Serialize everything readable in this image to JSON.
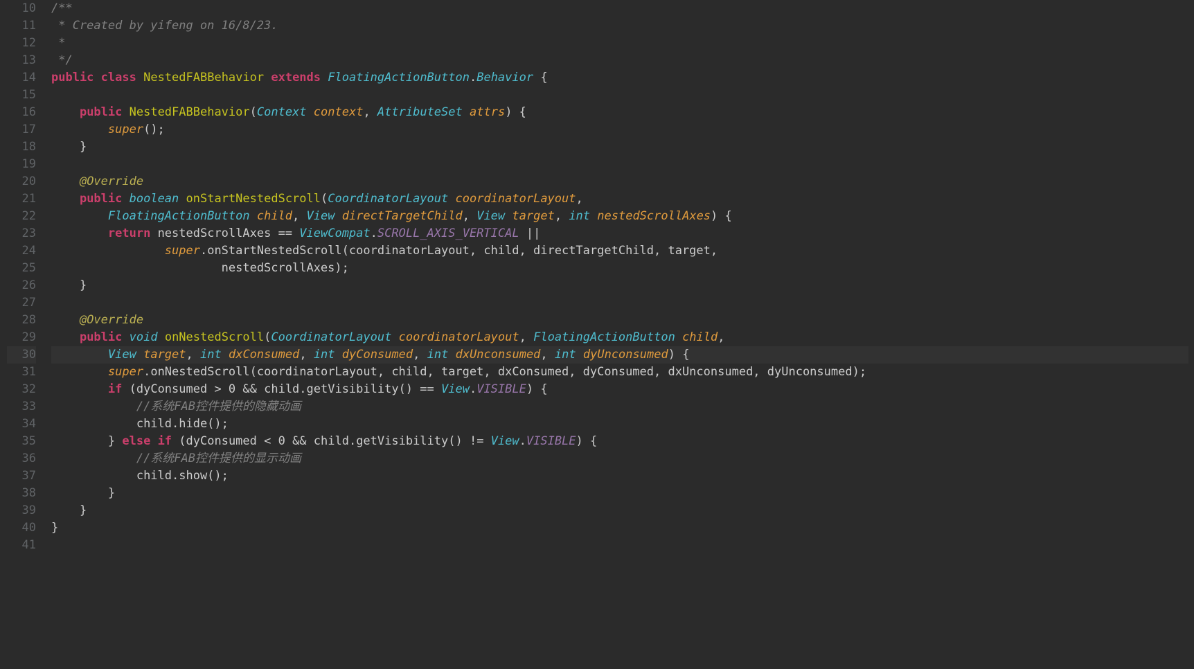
{
  "first_line_no": 10,
  "highlight_line": 30,
  "tokens": {
    "l10": {
      "comment": "/**"
    },
    "l11": {
      "comment": " * Created by yifeng on 16/8/23."
    },
    "l12": {
      "comment": " *"
    },
    "l13": {
      "comment": " */"
    },
    "l14": {
      "kw_public": "public",
      "kw_class": "class",
      "cls": "NestedFABBehavior",
      "kw_extends": "extends",
      "type": "FloatingActionButton",
      "dot": ".",
      "beh": "Behavior",
      "brace": " {"
    },
    "l16": {
      "kw_public": "public",
      "ctor": "NestedFABBehavior",
      "paren_o": "(",
      "t1": "Context",
      "p1": "context",
      "comma": ", ",
      "t2": "AttributeSet",
      "p2": "attrs",
      "paren_c": ")",
      "brace": " {"
    },
    "l17": {
      "super": "super",
      "rest": "();"
    },
    "l18": {
      "brace": "}"
    },
    "l20": {
      "annot": "@Override"
    },
    "l21": {
      "kw_public": "public",
      "t_ret": "boolean",
      "m": "onStartNestedScroll",
      "paren_o": "(",
      "t1": "CoordinatorLayout",
      "p1": "coordinatorLayout",
      "comma": ","
    },
    "l22": {
      "t1": "FloatingActionButton",
      "p1": "child",
      "c1": ", ",
      "t2": "View",
      "p2": "directTargetChild",
      "c2": ", ",
      "t3": "View",
      "p3": "target",
      "c3": ", ",
      "t4": "int",
      "p4": "nestedScrollAxes",
      "paren_c": ")",
      "brace": " {"
    },
    "l23": {
      "kw_return": "return",
      "p1": "nestedScrollAxes",
      "eq": " == ",
      "t": "ViewCompat",
      "dot": ".",
      "c": "SCROLL_AXIS_VERTICAL",
      "or": " ||"
    },
    "l24": {
      "super": "super",
      "dot": ".",
      "m": "onStartNestedScroll",
      "rest": "(coordinatorLayout, child, directTargetChild, target,"
    },
    "l25": {
      "rest": "nestedScrollAxes);"
    },
    "l26": {
      "brace": "}"
    },
    "l28": {
      "annot": "@Override"
    },
    "l29": {
      "kw_public": "public",
      "t_ret": "void",
      "m": "onNestedScroll",
      "paren_o": "(",
      "t1": "CoordinatorLayout",
      "p1": "coordinatorLayout",
      "c1": ", ",
      "t2": "FloatingActionButton",
      "p2": "child",
      "comma": ","
    },
    "l30": {
      "t1": "View",
      "p1": "target",
      "c1": ", ",
      "t2": "int",
      "p2": "dxConsumed",
      "c2": ", ",
      "t3": "int",
      "p3": "dyConsumed",
      "c3": ", ",
      "t4": "int",
      "p4": "dxUnconsumed",
      "c4": ", ",
      "t5": "int",
      "p5": "dyUnconsumed",
      "paren_c": ")",
      "brace": " {"
    },
    "l31": {
      "super": "super",
      "dot": ".",
      "m": "onNestedScroll",
      "rest": "(coordinatorLayout, child, target, dxConsumed, dyConsumed, dxUnconsumed, dyUnconsumed);"
    },
    "l32": {
      "kw_if": "if",
      "paren_o": " (",
      "p1": "dyConsumed > 0",
      "and": " && ",
      "p2": "child.getVisibility()",
      "eq": " == ",
      "t": "View",
      "dot": ".",
      "c": "VISIBLE",
      "paren_c": ")",
      "brace": " {"
    },
    "l33": {
      "comment": "//系统FAB控件提供的隐藏动画"
    },
    "l34": {
      "rest": "child.hide();"
    },
    "l35": {
      "brace_c": "}",
      "kw_else": "else if",
      "paren_o": " (",
      "p1": "dyConsumed < 0",
      "and": " && ",
      "p2": "child.getVisibility()",
      "neq": " != ",
      "t": "View",
      "dot": ".",
      "c": "VISIBLE",
      "paren_c": ")",
      "brace": " {"
    },
    "l36": {
      "comment": "//系统FAB控件提供的显示动画"
    },
    "l37": {
      "rest": "child.show();"
    },
    "l38": {
      "brace": "}"
    },
    "l39": {
      "brace": "}"
    },
    "l40": {
      "brace": "}"
    }
  }
}
